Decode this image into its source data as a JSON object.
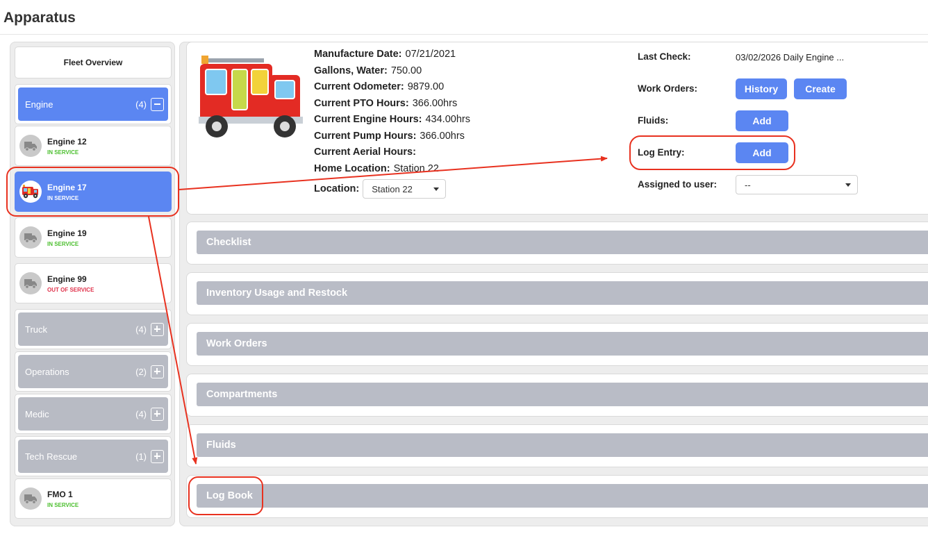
{
  "page": {
    "title": "Apparatus"
  },
  "sidebar": {
    "fleet_overview": "Fleet Overview",
    "groups": [
      {
        "name": "Engine",
        "count": "(4)",
        "expanded": true
      },
      {
        "name": "Truck",
        "count": "(4)",
        "expanded": false
      },
      {
        "name": "Operations",
        "count": "(2)",
        "expanded": false
      },
      {
        "name": "Medic",
        "count": "(4)",
        "expanded": false
      },
      {
        "name": "Tech Rescue",
        "count": "(1)",
        "expanded": false
      }
    ],
    "units": [
      {
        "name": "Engine 12",
        "status": "IN SERVICE"
      },
      {
        "name": "Engine 17",
        "status": "IN SERVICE",
        "selected": true
      },
      {
        "name": "Engine 19",
        "status": "IN SERVICE"
      },
      {
        "name": "Engine 99",
        "status": "OUT OF SERVICE"
      },
      {
        "name": "FMO 1",
        "status": "IN SERVICE"
      }
    ]
  },
  "details": {
    "specs": [
      {
        "label": "Manufacture Date:",
        "value": "07/21/2021"
      },
      {
        "label": "Gallons, Water:",
        "value": "750.00"
      },
      {
        "label": "Current Odometer:",
        "value": "9879.00"
      },
      {
        "label": "Current PTO Hours:",
        "value": "366.00hrs"
      },
      {
        "label": "Current Engine Hours:",
        "value": "434.00hrs"
      },
      {
        "label": "Current Pump Hours:",
        "value": "366.00hrs"
      },
      {
        "label": "Current Aerial Hours:",
        "value": ""
      },
      {
        "label": "Home Location:",
        "value": "Station 22"
      }
    ],
    "location_label": "Location:",
    "location_value": "Station 22",
    "last_check_label": "Last Check:",
    "last_check_value": "03/02/2026 Daily Engine ...",
    "work_orders_label": "Work Orders:",
    "history_button": "History",
    "create_button": "Create",
    "fluids_label": "Fluids:",
    "fluids_add_button": "Add",
    "log_entry_label": "Log Entry:",
    "log_entry_add_button": "Add",
    "assigned_label": "Assigned to user:",
    "assigned_value": "--"
  },
  "sections": [
    "Checklist",
    "Inventory Usage and Restock",
    "Work Orders",
    "Compartments",
    "Fluids",
    "Log Book"
  ],
  "colors": {
    "accent": "#5b86f2",
    "section_bar": "#b9bcc6",
    "in_service": "#4bbf2e",
    "out_of_service": "#e0334c",
    "annotation": "#e8311f"
  }
}
